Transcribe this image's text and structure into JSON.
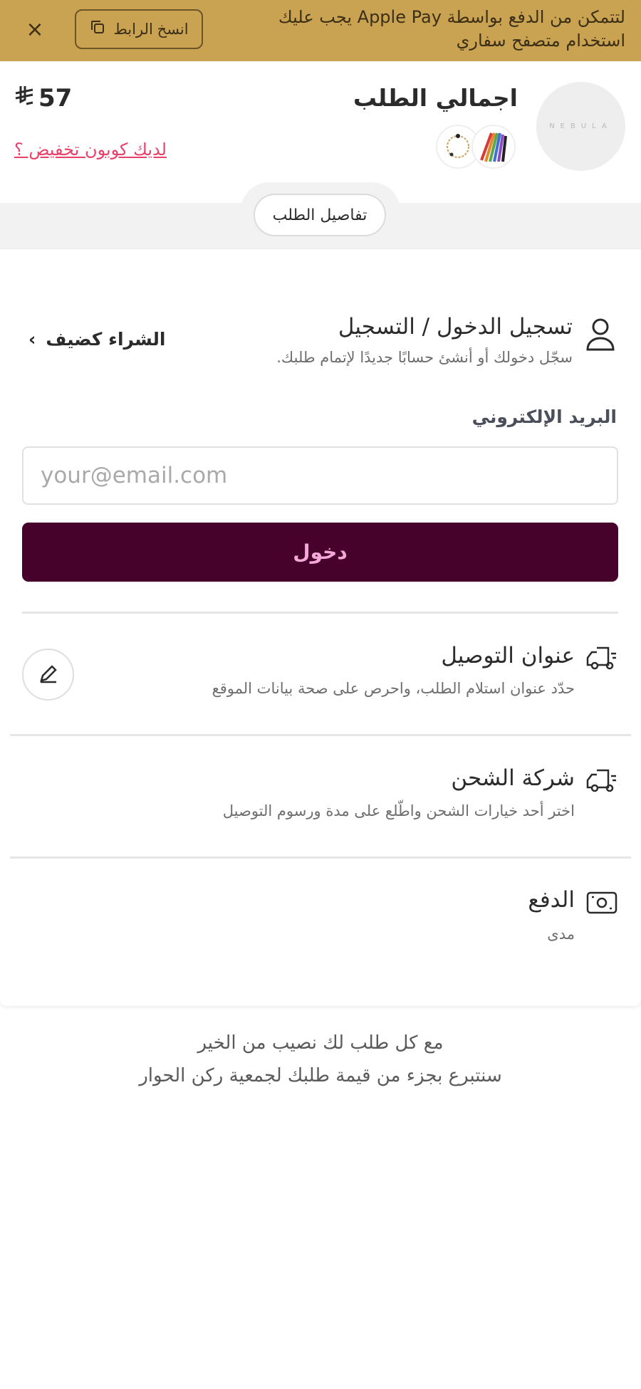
{
  "banner": {
    "message": "لتتمكن من الدفع بواسطة Apple Pay يجب عليك استخدام متصفح سفاري",
    "copy_link_label": "انسخ الرابط",
    "close_label": "×"
  },
  "order_summary": {
    "store_logo_text": "NEBULA",
    "total_label": "اجمالي الطلب",
    "total_amount": "57",
    "currency_icon": "riyal-sign-icon",
    "coupon_link": "لديك كوبون تخفيض ؟",
    "details_label": "تفاصيل الطلب",
    "item_thumbnails": [
      "colored-pens-thumbnail",
      "bracelet-thumbnail"
    ]
  },
  "login_section": {
    "title": "تسجيل الدخول / التسجيل",
    "subtitle": "سجّل دخولك أو أنشئ حسابًا جديدًا لإتمام طلبك.",
    "guest_label": "الشراء كضيف",
    "guest_chevron": "›",
    "email_label": "البريد الإلكتروني",
    "email_placeholder": "your@email.com",
    "email_value": "",
    "submit_label": "دخول"
  },
  "address_section": {
    "title": "عنوان التوصيل",
    "subtitle": "حدّد عنوان استلام الطلب، واحرص على صحة بيانات الموقع"
  },
  "shipping_section": {
    "title": "شركة الشحن",
    "subtitle": "اختر أحد خيارات الشحن واطّلع على مدة ورسوم التوصيل"
  },
  "payment_section": {
    "title": "الدفع",
    "subtitle": "مدى"
  },
  "footer": {
    "line1": "مع كل طلب لك نصيب من الخير",
    "line2": "سنتبرع بجزء من قيمة طلبك لجمعية ركن الحوار"
  },
  "colors": {
    "banner_bg": "#c9a252",
    "primary_button": "#46022b",
    "primary_button_text": "#f3a8d9",
    "coupon_link": "#e8416a"
  }
}
